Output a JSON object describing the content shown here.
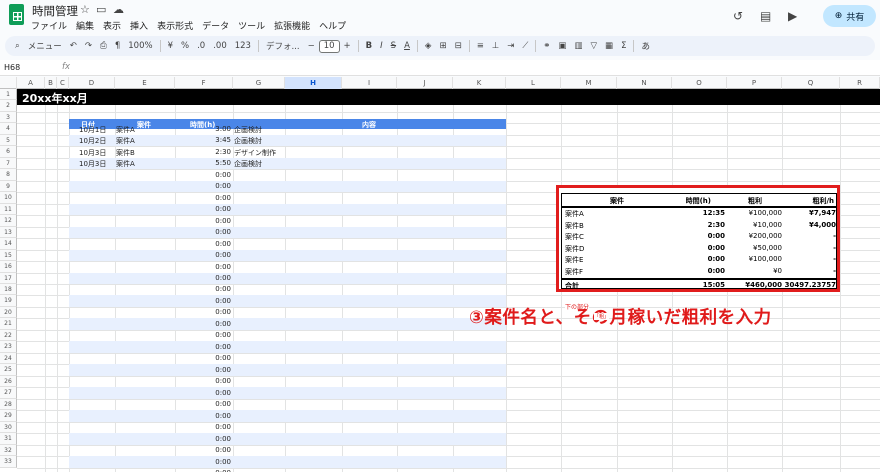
{
  "app": {
    "title": "時間管理",
    "menu": [
      "ファイル",
      "編集",
      "表示",
      "挿入",
      "表示形式",
      "データ",
      "ツール",
      "拡張機能",
      "ヘルプ"
    ],
    "share_label": "共有"
  },
  "toolbar": {
    "search_label": "メニュー",
    "zoom": "100%",
    "currency": "¥",
    "percent": "%",
    "decrease_decimal": ".0",
    "increase_decimal": ".00",
    "number_format": "123",
    "font": "デフォ...",
    "font_size": "10",
    "bold": "B",
    "italic": "I",
    "strike": "S",
    "text_color": "A",
    "input_tools": "あ"
  },
  "namebox": "H68",
  "fx": "fx",
  "columns": [
    "A",
    "B",
    "C",
    "D",
    "E",
    "F",
    "G",
    "H",
    "I",
    "J",
    "K",
    "L",
    "M",
    "N",
    "O",
    "P",
    "Q",
    "R"
  ],
  "selected_column": "H",
  "rows": [
    "1",
    "2",
    "3",
    "4",
    "5",
    "6",
    "7",
    "8",
    "9",
    "10",
    "11",
    "12",
    "13",
    "14",
    "15",
    "16",
    "17",
    "18",
    "19",
    "20",
    "21",
    "22",
    "23",
    "24",
    "25",
    "26",
    "27",
    "28",
    "29",
    "30",
    "31",
    "32",
    "33"
  ],
  "banner": "20xx年xx月",
  "time_table": {
    "headers": [
      "日付",
      "案件",
      "時間(h)",
      "内容"
    ],
    "rows": [
      {
        "date": "10月1日",
        "project": "案件A",
        "time": "3:00",
        "content": "企画検討"
      },
      {
        "date": "10月2日",
        "project": "案件A",
        "time": "3:45",
        "content": "企画検討"
      },
      {
        "date": "10月3日",
        "project": "案件B",
        "time": "2:30",
        "content": "デザイン制作"
      },
      {
        "date": "10月3日",
        "project": "案件A",
        "time": "5:50",
        "content": "企画検討"
      }
    ],
    "empty_time": "0:00"
  },
  "summary": {
    "headers": [
      "案件",
      "時間(h)",
      "粗利",
      "粗利/h"
    ],
    "rows": [
      {
        "project": "案件A",
        "time": "12:35",
        "profit": "¥100,000",
        "per_hour": "¥7,947"
      },
      {
        "project": "案件B",
        "time": "2:30",
        "profit": "¥10,000",
        "per_hour": "¥4,000"
      },
      {
        "project": "案件C",
        "time": "0:00",
        "profit": "¥200,000",
        "per_hour": "-"
      },
      {
        "project": "案件D",
        "time": "0:00",
        "profit": "¥50,000",
        "per_hour": "-"
      },
      {
        "project": "案件E",
        "time": "0:00",
        "profit": "¥100,000",
        "per_hour": "-"
      },
      {
        "project": "案件F",
        "time": "0:00",
        "profit": "¥0",
        "per_hour": "-"
      }
    ],
    "total": {
      "label": "合計",
      "time": "15:05",
      "profit": "¥460,000",
      "per_hour": "30497.23757"
    }
  },
  "annotation": {
    "text": "③案件名と、その月稼いだ粗利を入力",
    "small_1": "下の部分",
    "small_2": "「粗」"
  },
  "colors": {
    "accent": "#e11d1d",
    "header_blue": "#4a86e8",
    "band": "#e8f0fe",
    "share_bg": "#c2e7ff"
  }
}
